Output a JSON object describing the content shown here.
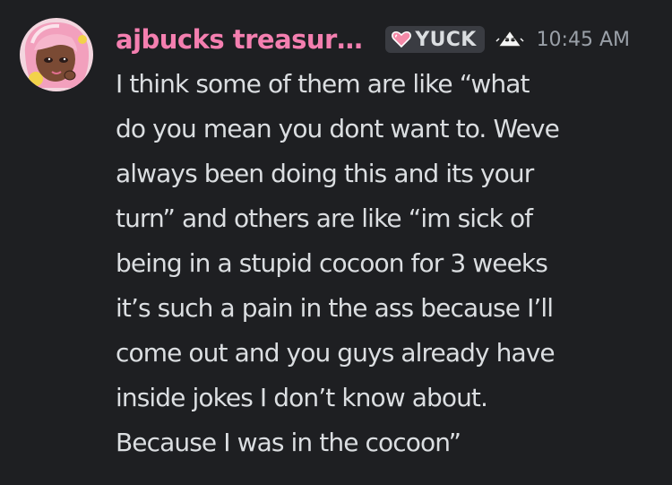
{
  "message": {
    "author": {
      "name": "ajbucks treasur…",
      "name_color": "#f47fb0",
      "avatar_icon": "pink-haired-character-avatar"
    },
    "tag": {
      "label": "YUCK",
      "icon": "pink-heart-icon"
    },
    "role_icon": "triangle-role-icon",
    "timestamp": "10:45 AM",
    "lines": [
      "I think some of them are like “what",
      "do you mean you dont want to. Weve",
      "always been doing this and its your",
      "turn” and others are like “im sick of",
      "being in a stupid cocoon for 3 weeks",
      "it’s such a pain in the ass because I’ll",
      "come out and you guys already have",
      "inside jokes I don’t know about.",
      "Because I was in the cocoon”"
    ]
  },
  "colors": {
    "background": "#1e1f22",
    "text": "#dbdee1",
    "muted": "#9aa0a8",
    "tag_background": "#3a3c42"
  }
}
